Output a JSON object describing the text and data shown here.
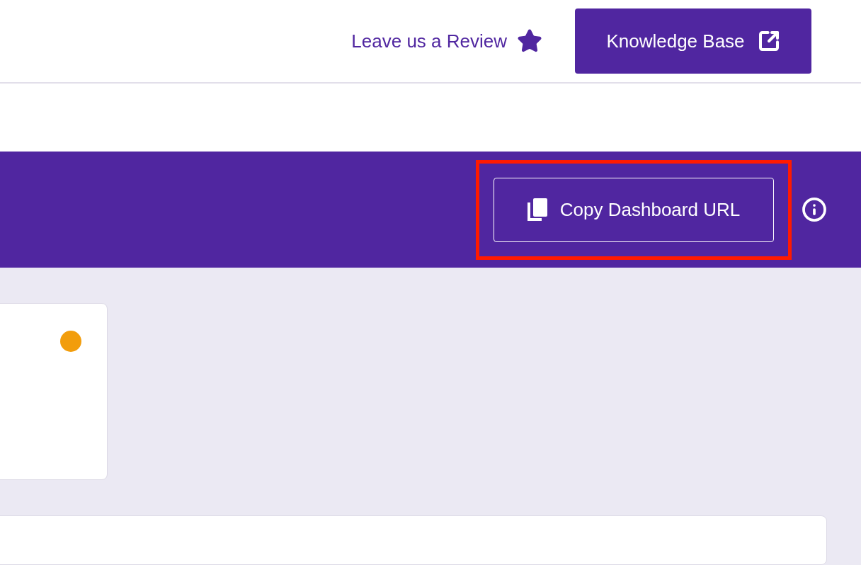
{
  "header": {
    "review_link": {
      "label": "Leave us a Review"
    },
    "knowledge_base_button": {
      "label": "Knowledge Base"
    }
  },
  "banner": {
    "copy_button": {
      "label": "Copy Dashboard URL",
      "highlighted": true
    }
  },
  "cards": [
    {
      "kind": "status",
      "color": "#f29d0c"
    },
    {
      "kind": "panel"
    }
  ]
}
